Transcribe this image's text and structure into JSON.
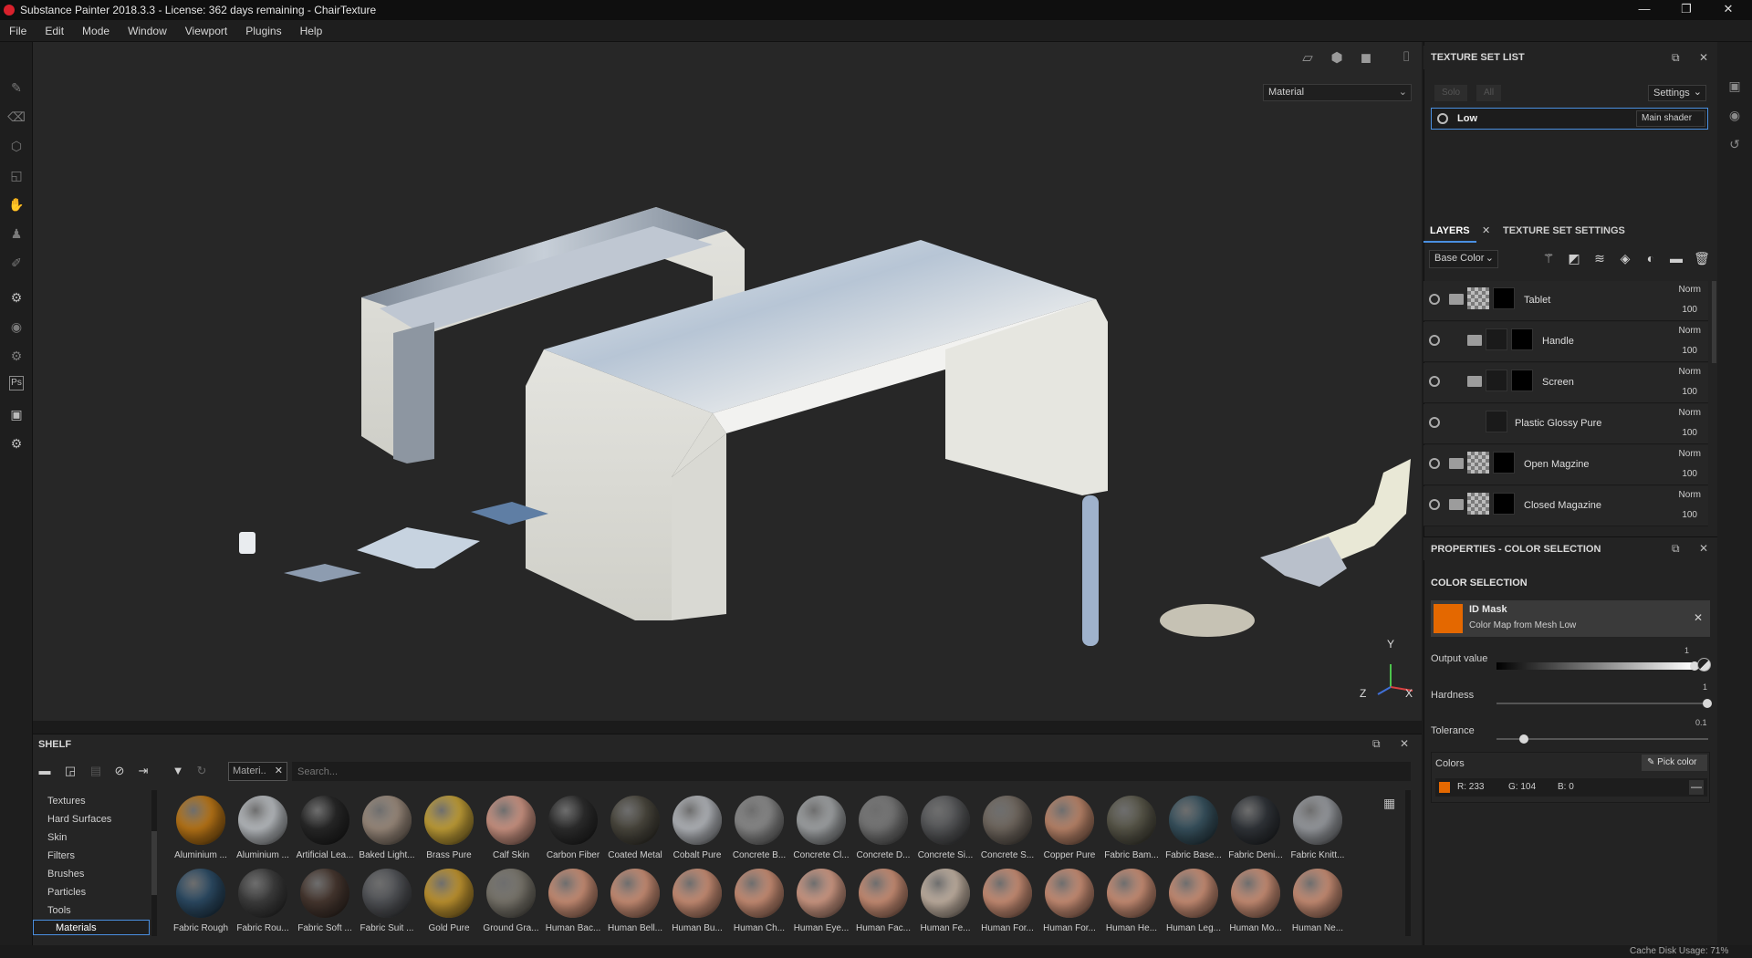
{
  "app": {
    "title": "Substance Painter 2018.3.3 - License: 362 days remaining - ChairTexture",
    "window_controls": [
      "—",
      "❐",
      "✕"
    ]
  },
  "menu": [
    "File",
    "Edit",
    "Mode",
    "Window",
    "Viewport",
    "Plugins",
    "Help"
  ],
  "viewport": {
    "channel_select": "Material",
    "axes": {
      "x": "X",
      "y": "Y",
      "z": "Z"
    }
  },
  "shelf": {
    "title": "SHELF",
    "filter_tag": "Materi..",
    "search_placeholder": "Search...",
    "categories": [
      "Textures",
      "Hard Surfaces",
      "Skin",
      "Filters",
      "Brushes",
      "Particles",
      "Tools",
      "Materials"
    ],
    "selected_category": "Materials",
    "materials_row1": [
      {
        "label": "Aluminium ...",
        "color": "#c07a18"
      },
      {
        "label": "Aluminium ...",
        "color": "#bfc3c7"
      },
      {
        "label": "Artificial Lea...",
        "color": "#2a2a2a"
      },
      {
        "label": "Baked Light...",
        "color": "#a08f80"
      },
      {
        "label": "Brass Pure",
        "color": "#c9a53a"
      },
      {
        "label": "Calf Skin",
        "color": "#d49a88"
      },
      {
        "label": "Carbon Fiber",
        "color": "#2f2f2f"
      },
      {
        "label": "Coated Metal",
        "color": "#4d4a40"
      },
      {
        "label": "Cobalt Pure",
        "color": "#b9bcc1"
      },
      {
        "label": "Concrete B...",
        "color": "#8e8e8e"
      },
      {
        "label": "Concrete Cl...",
        "color": "#a6a9ab"
      },
      {
        "label": "Concrete D...",
        "color": "#7a7a7a"
      },
      {
        "label": "Concrete Si...",
        "color": "#5a5b5d"
      },
      {
        "label": "Concrete S...",
        "color": "#746b62"
      },
      {
        "label": "Copper Pure",
        "color": "#c28a6e"
      },
      {
        "label": "Fabric Bam...",
        "color": "#5c5a4c"
      },
      {
        "label": "Fabric Base...",
        "color": "#3a5562"
      },
      {
        "label": "Fabric Deni...",
        "color": "#33373c"
      },
      {
        "label": "Fabric Knitt...",
        "color": "#9da0a5"
      }
    ],
    "materials_row2": [
      {
        "label": "Fabric Rough",
        "color": "#2e4e68"
      },
      {
        "label": "Fabric Rou...",
        "color": "#404040"
      },
      {
        "label": "Fabric Soft ...",
        "color": "#4a3a32"
      },
      {
        "label": "Fabric Suit ...",
        "color": "#55575b"
      },
      {
        "label": "Gold Pure",
        "color": "#c79a32"
      },
      {
        "label": "Ground Gra...",
        "color": "#7e7a70"
      },
      {
        "label": "Human Bac...",
        "color": "#d1947a"
      },
      {
        "label": "Human Bell...",
        "color": "#d1947a"
      },
      {
        "label": "Human Bu...",
        "color": "#d1947a"
      },
      {
        "label": "Human Ch...",
        "color": "#d1947a"
      },
      {
        "label": "Human Eye...",
        "color": "#d8a08a"
      },
      {
        "label": "Human Fac...",
        "color": "#d1947a"
      },
      {
        "label": "Human Fe...",
        "color": "#c9b8a8"
      },
      {
        "label": "Human For...",
        "color": "#d1947a"
      },
      {
        "label": "Human For...",
        "color": "#d1947a"
      },
      {
        "label": "Human He...",
        "color": "#d1947a"
      },
      {
        "label": "Human Leg...",
        "color": "#d1947a"
      },
      {
        "label": "Human Mo...",
        "color": "#d1947a"
      },
      {
        "label": "Human Ne...",
        "color": "#d1947a"
      }
    ]
  },
  "texture_set_list": {
    "title": "TEXTURE SET LIST",
    "solo": "Solo",
    "all": "All",
    "settings": "Settings",
    "set_name": "Low",
    "shader": "Main shader"
  },
  "layers": {
    "tab_layers": "LAYERS",
    "tab_tss": "TEXTURE SET SETTINGS",
    "channel": "Base Color",
    "items": [
      {
        "name": "Tablet",
        "blend": "Norm",
        "opacity": "100"
      },
      {
        "name": "Handle",
        "blend": "Norm",
        "opacity": "100"
      },
      {
        "name": "Screen",
        "blend": "Norm",
        "opacity": "100"
      },
      {
        "name": "Plastic Glossy Pure",
        "blend": "Norm",
        "opacity": "100"
      },
      {
        "name": "Open Magzine",
        "blend": "Norm",
        "opacity": "100"
      },
      {
        "name": "Closed Magazine",
        "blend": "Norm",
        "opacity": "100"
      }
    ]
  },
  "properties": {
    "title": "PROPERTIES - COLOR SELECTION",
    "section": "COLOR SELECTION",
    "mask_name": "ID Mask",
    "mask_source": "Color Map from Mesh Low",
    "output_label": "Output value",
    "output_value": "1",
    "hardness_label": "Hardness",
    "hardness_value": "1",
    "tolerance_label": "Tolerance",
    "tolerance_value": "0.1",
    "colors_label": "Colors",
    "pick_color": "Pick color",
    "color_r": "R: 233",
    "color_g": "G: 104",
    "color_b": "B: 0",
    "swatch": "#e46800"
  },
  "status": {
    "cache": "Cache Disk Usage:  71%"
  }
}
